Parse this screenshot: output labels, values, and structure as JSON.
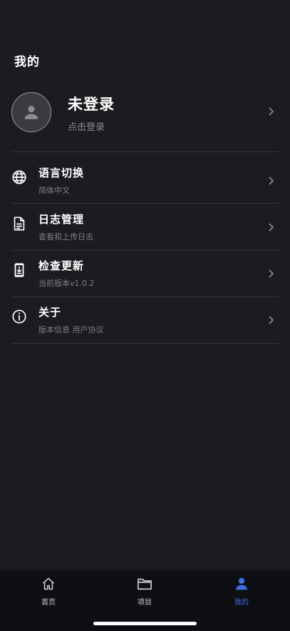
{
  "header": {
    "title": "我的"
  },
  "profile": {
    "name": "未登录",
    "subtitle": "点击登录",
    "avatar_icon": "user-icon"
  },
  "menu": [
    {
      "label": "语言切换",
      "sub": "简体中文",
      "icon": "globe-icon"
    },
    {
      "label": "日志管理",
      "sub": "查看和上传日志",
      "icon": "document-icon"
    },
    {
      "label": "检查更新",
      "sub": "当前版本v1.0.2",
      "icon": "phone-download-icon"
    },
    {
      "label": "关于",
      "sub": "版本信息 用户协议",
      "icon": "info-icon"
    }
  ],
  "tabbar": {
    "tabs": [
      {
        "label": "首页",
        "icon": "home-icon",
        "active": false
      },
      {
        "label": "项目",
        "icon": "folder-icon",
        "active": false
      },
      {
        "label": "我的",
        "icon": "person-icon",
        "active": true
      }
    ]
  },
  "colors": {
    "background": "#1b1c20",
    "tabbar": "#0e0f12",
    "accent": "#3b6ee8",
    "secondary_text": "#7e7f85"
  }
}
